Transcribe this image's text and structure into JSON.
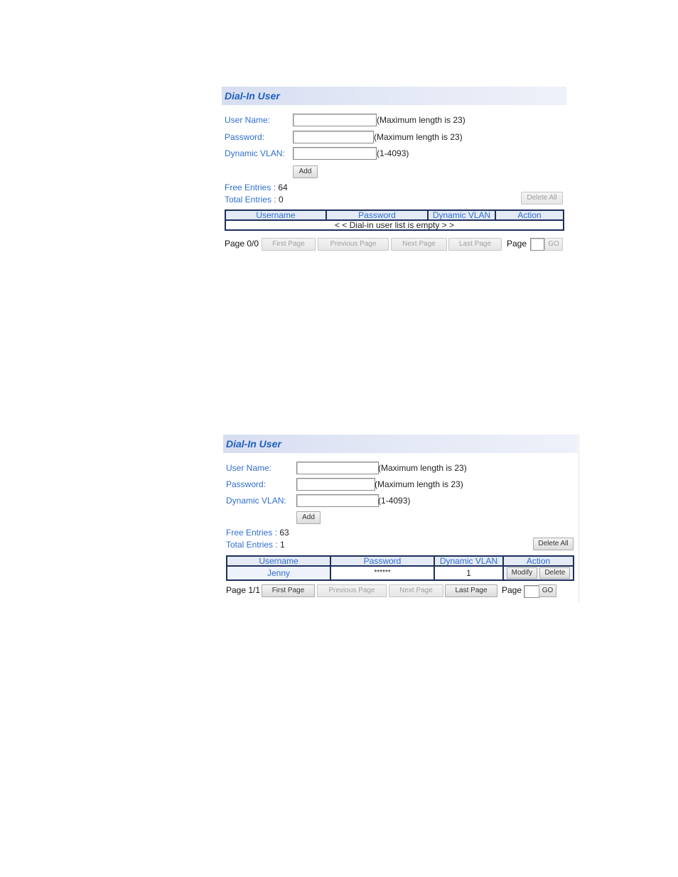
{
  "panels": [
    {
      "title": "Dial-In User",
      "form": {
        "username": {
          "label": "User Name:",
          "value": "",
          "hint": "(Maximum length is 23)"
        },
        "password": {
          "label": "Password:",
          "value": "",
          "hint": "(Maximum length is 23)"
        },
        "vlan": {
          "label": "Dynamic VLAN:",
          "value": "",
          "hint": "(1-4093)"
        },
        "add_label": "Add"
      },
      "stats": {
        "free_label": "Free Entries :",
        "free_value": "64",
        "total_label": "Total Entries :",
        "total_value": "0"
      },
      "delete_all_label": "Delete All",
      "table": {
        "columns": [
          "Username",
          "Password",
          "Dynamic VLAN",
          "Action"
        ],
        "empty_message": "< < Dial-in user list is empty > >",
        "rows": []
      },
      "pager": {
        "status": "Page 0/0",
        "first": "First Page",
        "previous": "Previous Page",
        "next": "Next Page",
        "last": "Last Page",
        "page_label": "Page",
        "page_value": "",
        "go": "GO"
      }
    },
    {
      "title": "Dial-In User",
      "form": {
        "username": {
          "label": "User Name:",
          "value": "",
          "hint": "(Maximum length is 23)"
        },
        "password": {
          "label": "Password:",
          "value": "",
          "hint": "(Maximum length is 23)"
        },
        "vlan": {
          "label": "Dynamic VLAN:",
          "value": "",
          "hint": "(1-4093)"
        },
        "add_label": "Add"
      },
      "stats": {
        "free_label": "Free Entries :",
        "free_value": "63",
        "total_label": "Total Entries :",
        "total_value": "1"
      },
      "delete_all_label": "Delete All",
      "table": {
        "columns": [
          "Username",
          "Password",
          "Dynamic VLAN",
          "Action"
        ],
        "rows": [
          {
            "username": "Jenny",
            "password": "******",
            "vlan": "1",
            "modify": "Modify",
            "delete": "Delete"
          }
        ]
      },
      "pager": {
        "status": "Page 1/1",
        "first": "First Page",
        "previous": "Previous Page",
        "next": "Next Page",
        "last": "Last Page",
        "page_label": "Page",
        "page_value": "",
        "go": "GO"
      }
    }
  ]
}
